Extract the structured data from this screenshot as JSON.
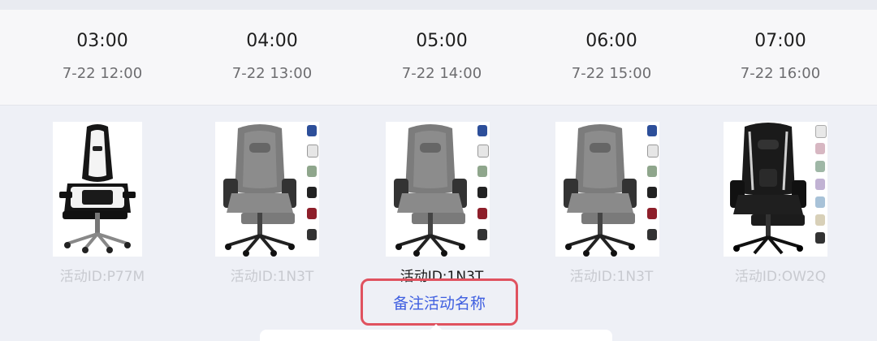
{
  "slots": [
    {
      "time": "03:00",
      "date": "7-22 12:00",
      "activity": "活动ID:P77M",
      "active": false,
      "chair": "black-white",
      "strip": false
    },
    {
      "time": "04:00",
      "date": "7-22 13:00",
      "activity": "活动ID:1N3T",
      "active": false,
      "chair": "grey",
      "strip": true
    },
    {
      "time": "05:00",
      "date": "7-22 14:00",
      "activity": "活动ID:1N3T",
      "active": true,
      "chair": "grey",
      "strip": true
    },
    {
      "time": "06:00",
      "date": "7-22 15:00",
      "activity": "活动ID:1N3T",
      "active": false,
      "chair": "grey",
      "strip": true
    },
    {
      "time": "07:00",
      "date": "7-22 16:00",
      "activity": "活动ID:OW2Q",
      "active": false,
      "chair": "black",
      "strip": true
    }
  ],
  "note_button": {
    "label": "备注活动名称"
  },
  "colors": {
    "accent": "#3f5fe0",
    "highlight_border": "#e0525f",
    "muted_text": "#c8cad0"
  }
}
